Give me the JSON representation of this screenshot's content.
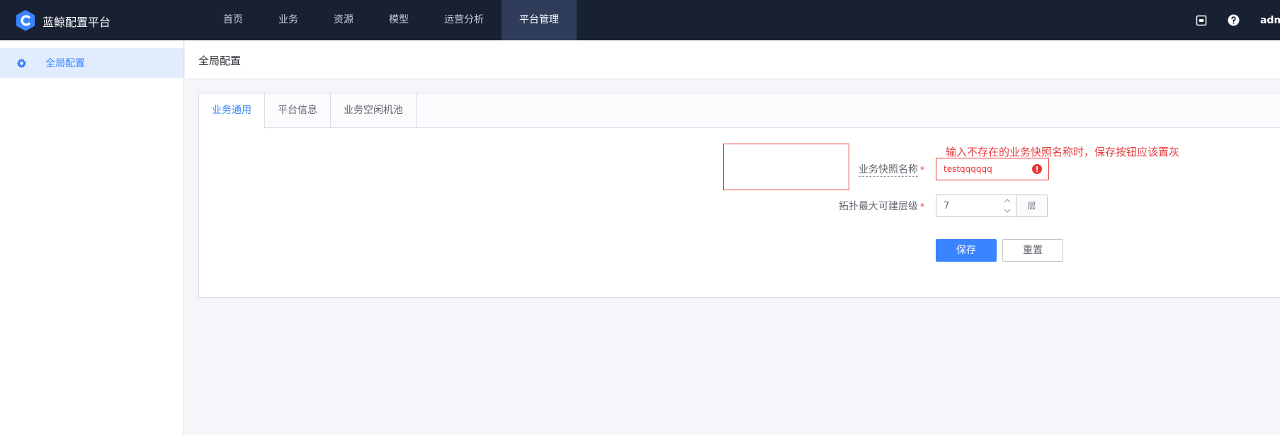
{
  "app": {
    "brand": "蓝鲸配置平台",
    "accent_color": "#3a84ff",
    "topbar_color": "#182132"
  },
  "nav": {
    "items": [
      {
        "label": "首页",
        "active": false
      },
      {
        "label": "业务",
        "active": false
      },
      {
        "label": "资源",
        "active": false
      },
      {
        "label": "模型",
        "active": false
      },
      {
        "label": "运营分析",
        "active": false
      },
      {
        "label": "平台管理",
        "active": true
      }
    ]
  },
  "top_right": {
    "icons": [
      "screen-icon",
      "help-icon"
    ],
    "user": "adm"
  },
  "sidebar": {
    "items": [
      {
        "label": "全局配置",
        "icon": "gear-icon",
        "active": true
      }
    ]
  },
  "page": {
    "title": "全局配置"
  },
  "tabs": [
    {
      "label": "业务通用",
      "active": true
    },
    {
      "label": "平台信息",
      "active": false
    },
    {
      "label": "业务空闲机池",
      "active": false
    }
  ],
  "form": {
    "snapshot_name": {
      "label": "业务快照名称",
      "required_mark": "*",
      "value": "testqqqqqq",
      "error_icon": "error-icon"
    },
    "max_topo_level": {
      "label": "拓扑最大可建层级",
      "required_mark": "*",
      "value": "7",
      "unit": "层"
    },
    "buttons": {
      "save": "保存",
      "reset": "重置"
    }
  },
  "annotation": {
    "text": "输入不存在的业务快照名称时，保存按钮应该置灰",
    "color": "#e53b3b"
  }
}
